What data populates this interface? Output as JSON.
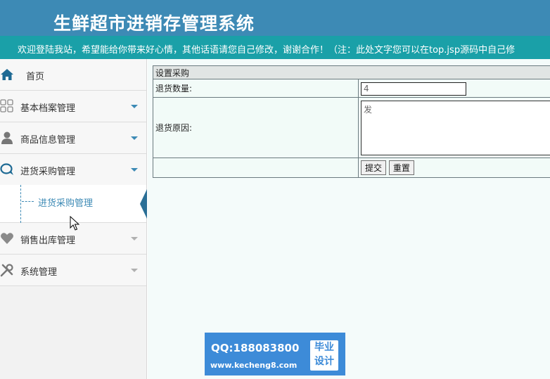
{
  "header": {
    "title": "生鲜超市进销存管理系统",
    "background": "#3d8ab5"
  },
  "marquee": {
    "text": "欢迎登陆我站，希望能给你带来好心情，其他话语请您自己修改，谢谢合作！（注：此处文字您可以在top.jsp源码中自己修"
  },
  "sidebar": {
    "items": [
      {
        "label": "首页",
        "icon": "home-icon"
      },
      {
        "label": "基本档案管理",
        "icon": "grid-icon"
      },
      {
        "label": "商品信息管理",
        "icon": "user-icon"
      },
      {
        "label": "进货采购管理",
        "icon": "chat-bubbles-icon"
      },
      {
        "label": "销售出库管理",
        "icon": "heart-icon"
      },
      {
        "label": "系统管理",
        "icon": "tools-icon"
      }
    ],
    "submenu": {
      "label": "进货采购管理"
    }
  },
  "form": {
    "title": "设置采购",
    "qty_label": "退货数量:",
    "qty_value": "4",
    "reason_label": "退货原因:",
    "reason_value": "发",
    "submit_label": "提交",
    "reset_label": "重置"
  },
  "watermark": {
    "qq": "QQ:188083800",
    "url": "www.kecheng8.com",
    "badge_line1": "毕业",
    "badge_line2": "设计"
  },
  "colors": {
    "accent": "#3d8ab5",
    "marquee": "#1aa0a8",
    "content_bg": "#f4fbfa"
  }
}
